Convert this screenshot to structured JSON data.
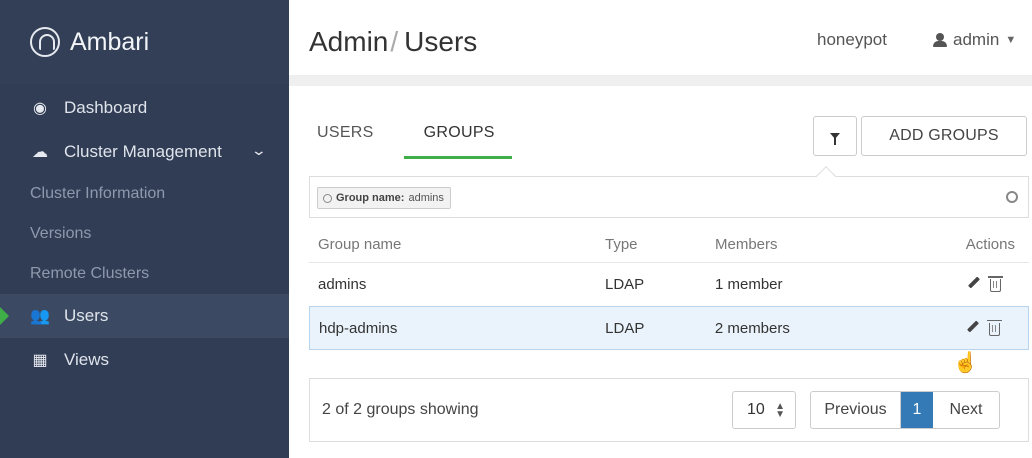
{
  "brand": {
    "name": "Ambari"
  },
  "sidebar": {
    "items": [
      {
        "label": "Dashboard",
        "icon": "dashboard-icon"
      },
      {
        "label": "Cluster Management",
        "icon": "cloud-icon"
      },
      {
        "label": "Cluster Information"
      },
      {
        "label": "Versions"
      },
      {
        "label": "Remote Clusters"
      },
      {
        "label": "Users",
        "icon": "users-icon"
      },
      {
        "label": "Views",
        "icon": "grid-icon"
      }
    ]
  },
  "header": {
    "title_parent": "Admin",
    "title_sep": "/",
    "title_current": "Users",
    "cluster_name": "honeypot",
    "user": "admin"
  },
  "tabs": {
    "users": "USERS",
    "groups": "GROUPS"
  },
  "toolbar": {
    "add_groups": "ADD GROUPS"
  },
  "filter": {
    "chip_key": "Group name:",
    "chip_value": "admins"
  },
  "table": {
    "headers": {
      "name": "Group name",
      "type": "Type",
      "members": "Members",
      "actions": "Actions"
    },
    "rows": [
      {
        "name": "admins",
        "type": "LDAP",
        "members": "1 member"
      },
      {
        "name": "hdp-admins",
        "type": "LDAP",
        "members": "2 members"
      }
    ]
  },
  "footer": {
    "count_text": "2 of 2 groups showing",
    "page_size": "10",
    "prev": "Previous",
    "current_page": "1",
    "next": "Next"
  },
  "colors": {
    "sidebar": "#313d54",
    "accent": "#3fae49",
    "primary": "#337ab7"
  }
}
